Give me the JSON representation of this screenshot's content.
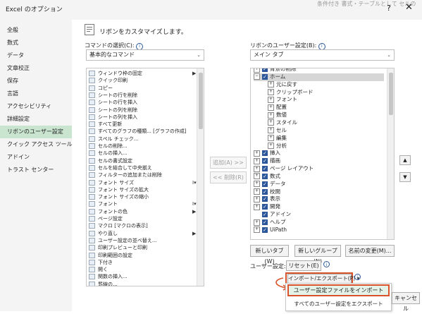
{
  "window": {
    "title": "Excel のオプション",
    "help_glyph": "?",
    "close_glyph": "✕",
    "bg_text": "条件付き 書式・テーブルとして セルの"
  },
  "sidebar": {
    "items": [
      {
        "label": "全般"
      },
      {
        "label": "数式"
      },
      {
        "label": "データ"
      },
      {
        "label": "文章校正"
      },
      {
        "label": "保存"
      },
      {
        "label": "言語"
      },
      {
        "label": "アクセシビリティ"
      },
      {
        "label": "詳細設定"
      },
      {
        "label": "リボンのユーザー設定",
        "selected": true
      },
      {
        "label": "クイック アクセス ツール バー"
      },
      {
        "label": "アドイン"
      },
      {
        "label": "トラスト センター"
      }
    ]
  },
  "header": {
    "title": "リボンをカスタマイズします。"
  },
  "left": {
    "label": "コマンドの選択(C):",
    "dropdown_value": "基本的なコマンド",
    "commands": [
      {
        "label": "ウィンドウ枠の固定",
        "sub": "▶"
      },
      {
        "label": "クイック印刷",
        "sub": ""
      },
      {
        "label": "コピー",
        "sub": ""
      },
      {
        "label": "シートの行を削除",
        "sub": ""
      },
      {
        "label": "シートの行を挿入",
        "sub": ""
      },
      {
        "label": "シートの列を削除",
        "sub": ""
      },
      {
        "label": "シートの列を挿入",
        "sub": ""
      },
      {
        "label": "すべて更新",
        "sub": ""
      },
      {
        "label": "すべてのグラフの種類... [グラフの作成]",
        "sub": ""
      },
      {
        "label": "スペル チェック...",
        "sub": ""
      },
      {
        "label": "セルの削除...",
        "sub": ""
      },
      {
        "label": "セルの挿入...",
        "sub": ""
      },
      {
        "label": "セルの書式設定",
        "sub": ""
      },
      {
        "label": "セルを結合して中央揃え",
        "sub": ""
      },
      {
        "label": "フィルターの追加または削除",
        "sub": ""
      },
      {
        "label": "フォント サイズ",
        "sub": "I▾"
      },
      {
        "label": "フォント サイズの拡大",
        "sub": ""
      },
      {
        "label": "フォント サイズの縮小",
        "sub": ""
      },
      {
        "label": "フォント",
        "sub": "I▾"
      },
      {
        "label": "フォントの色",
        "sub": "▶"
      },
      {
        "label": "ページ設定",
        "sub": ""
      },
      {
        "label": "マクロ [マクロの表示]",
        "sub": ""
      },
      {
        "label": "やり直し",
        "sub": "▶"
      },
      {
        "label": "ユーザー設定の並べ替え...",
        "sub": ""
      },
      {
        "label": "印刷プレビューと印刷",
        "sub": ""
      },
      {
        "label": "印刷範囲の設定",
        "sub": ""
      },
      {
        "label": "下付き",
        "sub": ""
      },
      {
        "label": "開く",
        "sub": ""
      },
      {
        "label": "関数の挿入...",
        "sub": ""
      },
      {
        "label": "罫線の...",
        "sub": ""
      }
    ]
  },
  "middle": {
    "add_label": "追加(A) >>",
    "remove_label": "<< 削除(R)"
  },
  "right": {
    "label": "リボンのユーザー設定(B):",
    "dropdown_value": "メイン タブ",
    "tree": [
      {
        "label": "背景の削除",
        "level": 0,
        "expander": "⊞",
        "checked": true
      },
      {
        "label": "ホーム",
        "level": 0,
        "expander": "⊟",
        "checked": true,
        "selected": true
      },
      {
        "label": "元に戻す",
        "level": 1,
        "expander": "⊞"
      },
      {
        "label": "クリップボード",
        "level": 1,
        "expander": "⊞"
      },
      {
        "label": "フォント",
        "level": 1,
        "expander": "⊞"
      },
      {
        "label": "配置",
        "level": 1,
        "expander": "⊞"
      },
      {
        "label": "数値",
        "level": 1,
        "expander": "⊞"
      },
      {
        "label": "スタイル",
        "level": 1,
        "expander": "⊞"
      },
      {
        "label": "セル",
        "level": 1,
        "expander": "⊞"
      },
      {
        "label": "編集",
        "level": 1,
        "expander": "⊞"
      },
      {
        "label": "分析",
        "level": 1,
        "expander": "⊞"
      },
      {
        "label": "挿入",
        "level": 0,
        "expander": "⊞",
        "checked": true
      },
      {
        "label": "描画",
        "level": 0,
        "expander": "⊞",
        "checked": true
      },
      {
        "label": "ページ レイアウト",
        "level": 0,
        "expander": "⊞",
        "checked": true
      },
      {
        "label": "数式",
        "level": 0,
        "expander": "⊞",
        "checked": true
      },
      {
        "label": "データ",
        "level": 0,
        "expander": "⊞",
        "checked": true
      },
      {
        "label": "校閲",
        "level": 0,
        "expander": "⊞",
        "checked": true
      },
      {
        "label": "表示",
        "level": 0,
        "expander": "⊞",
        "checked": true
      },
      {
        "label": "開発",
        "level": 0,
        "expander": "⊞",
        "checked": true
      },
      {
        "label": "アドイン",
        "level": 0,
        "expander": "",
        "checked": true
      },
      {
        "label": "ヘルプ",
        "level": 0,
        "expander": "⊞",
        "checked": true
      },
      {
        "label": "UiPath",
        "level": 0,
        "expander": "⊞",
        "checked": true
      }
    ],
    "buttons": {
      "new_tab": "新しいタブ(W)",
      "new_group": "新しいグループ(N)",
      "rename": "名前の変更(M)..."
    },
    "user_settings_label": "ユーザー設定:",
    "reset_label": "リセット(E) ▾",
    "import_export_label": "インポート/エクスポート(P) ▾",
    "menu": {
      "import": "ユーザー設定ファイルをインポート",
      "export": "すべてのユーザー設定をエクスポート"
    },
    "move_up": "▲",
    "move_down": "▼"
  },
  "footer": {
    "cancel": "キャンセル"
  },
  "colors": {
    "selected_sidebar": "#c9e4cf",
    "accent_checkbox": "#2b579a",
    "highlight": "#d9532c"
  }
}
